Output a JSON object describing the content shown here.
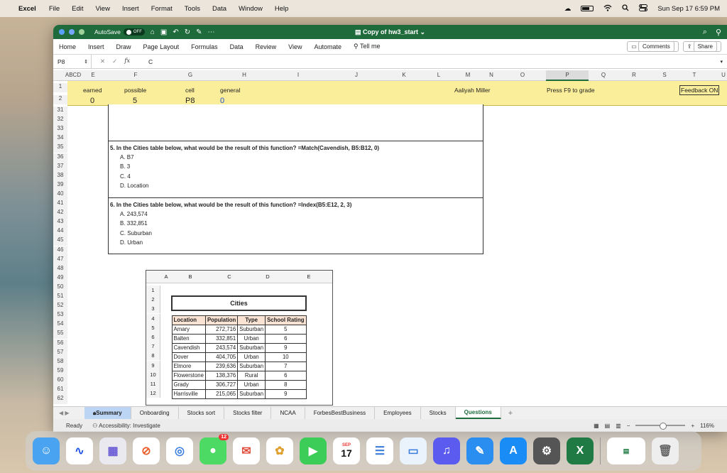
{
  "menubar": {
    "apple": "",
    "app": "Excel",
    "items": [
      "File",
      "Edit",
      "View",
      "Insert",
      "Format",
      "Tools",
      "Data",
      "Window",
      "Help"
    ],
    "datetime": "Sun Sep 17  6:59 PM"
  },
  "titlebar": {
    "autosave_label": "AutoSave",
    "autosave_state": "OFF",
    "doc_title": "Copy of hw3_start"
  },
  "ribbon": {
    "tabs": [
      "Home",
      "Insert",
      "Draw",
      "Page Layout",
      "Formulas",
      "Data",
      "Review",
      "View",
      "Automate"
    ],
    "tell_me": "Tell me",
    "comments": "Comments",
    "share": "Share"
  },
  "formula_bar": {
    "name_box": "P8",
    "formula": "C"
  },
  "columns": [
    "ABCD",
    "E",
    "F",
    "G",
    "H",
    "I",
    "J",
    "K",
    "L",
    "M",
    "N",
    "O",
    "P",
    "Q",
    "R",
    "S",
    "T",
    "U"
  ],
  "rows": [
    "1",
    "2",
    "31",
    "32",
    "33",
    "34",
    "35",
    "36",
    "37",
    "38",
    "39",
    "40",
    "41",
    "42",
    "43",
    "44",
    "45",
    "46",
    "47",
    "48",
    "49",
    "50",
    "51",
    "52",
    "53",
    "54",
    "55",
    "56",
    "57",
    "58",
    "59",
    "60",
    "61",
    "62"
  ],
  "header_row": {
    "earned": "earned",
    "possible": "possible",
    "cell": "cell",
    "general": "general",
    "name": "Aaliyah Miller",
    "press": "Press F9 to grade",
    "feedback": "Feedback ON"
  },
  "values_row": {
    "earned": "0",
    "possible": "5",
    "cell": "P8",
    "general": "0"
  },
  "questions": [
    {
      "text": "5. In the Cities table below, what would be the result of this function?  =Match(Cavendish, B5:B12, 0)",
      "options": [
        "A.  B7",
        "B.  3",
        "C.  4",
        "D.  Location"
      ]
    },
    {
      "text": "6. In the Cities table below, what would be the result of this function?  =Index(B5:E12, 2, 3)",
      "options": [
        "A.  243,574",
        "B.  332,851",
        "C.  Suburban",
        "D.  Urban"
      ]
    }
  ],
  "embedded_sheet": {
    "cols": [
      "A",
      "B",
      "C",
      "D",
      "E"
    ],
    "rows": [
      "1",
      "2",
      "3",
      "4",
      "5",
      "6",
      "7",
      "8",
      "9",
      "10",
      "11",
      "12"
    ],
    "title": "Cities",
    "headers": [
      "Location",
      "Population",
      "Type",
      "School Rating"
    ],
    "data": [
      [
        "Amary",
        "272,716",
        "Suburban",
        "5"
      ],
      [
        "Balten",
        "332,851",
        "Urban",
        "6"
      ],
      [
        "Cavendish",
        "243,574",
        "Suburban",
        "9"
      ],
      [
        "Dover",
        "404,705",
        "Urban",
        "10"
      ],
      [
        "Elmore",
        "239,636",
        "Suburban",
        "7"
      ],
      [
        "Flowerstone",
        "138,376",
        "Rural",
        "6"
      ],
      [
        "Grady",
        "306,727",
        "Urban",
        "8"
      ],
      [
        "Harrisville",
        "215,065",
        "Suburban",
        "9"
      ]
    ]
  },
  "sheet_tabs": [
    "Summary",
    "Onboarding",
    "Stocks sort",
    "Stocks filter",
    "NCAA",
    "ForbesBestBusiness",
    "Employees",
    "Stocks",
    "Questions"
  ],
  "status": {
    "ready": "Ready",
    "accessibility": "Accessibility: Investigate",
    "zoom": "116%"
  },
  "dock": {
    "messages_badge": "12",
    "calendar_month": "SEP",
    "calendar_day": "17"
  }
}
